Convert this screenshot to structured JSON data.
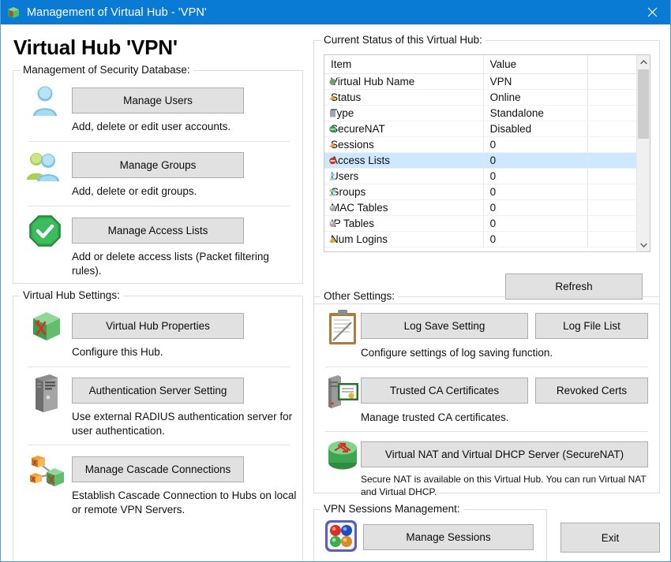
{
  "window": {
    "title": "Management of Virtual Hub - 'VPN'",
    "icon": "virtual-hub-cube-icon",
    "close_label": "✕",
    "accent_color": "#0a7bd4",
    "button_face": "#e1e1e1",
    "selection_color": "#cde8ff"
  },
  "page_title": "Virtual Hub 'VPN'",
  "security_db": {
    "legend": "Management of Security Database:",
    "items": [
      {
        "icon": "user-icon",
        "button": "Manage Users",
        "desc": "Add, delete or edit user accounts."
      },
      {
        "icon": "group-users-icon",
        "button": "Manage Groups",
        "desc": "Add, delete or edit groups."
      },
      {
        "icon": "green-check-icon",
        "button": "Manage Access Lists",
        "desc": "Add or delete access lists (Packet filtering rules)."
      }
    ]
  },
  "hub_settings": {
    "legend": "Virtual Hub Settings:",
    "items": [
      {
        "icon": "virtual-hub-cube-icon",
        "button": "Virtual Hub Properties",
        "desc": "Configure this Hub."
      },
      {
        "icon": "server-tower-icon",
        "button": "Authentication Server Setting",
        "desc": "Use external RADIUS authentication server for user authentication."
      },
      {
        "icon": "cascade-connection-icon",
        "button": "Manage Cascade Connections",
        "desc": "Establish Cascade Connection to Hubs on local or remote VPN Servers."
      }
    ]
  },
  "status": {
    "legend": "Current Status of this Virtual Hub:",
    "columns": [
      "Item",
      "Value",
      ""
    ],
    "rows": [
      {
        "icon": "hub-dot-icon",
        "item": "Virtual Hub Name",
        "value": "VPN",
        "selected": false
      },
      {
        "icon": "status-up-icon",
        "item": "Status",
        "value": "Online",
        "selected": false
      },
      {
        "icon": "type-icon",
        "item": "Type",
        "value": "Standalone",
        "selected": false
      },
      {
        "icon": "securenat-icon",
        "item": "SecureNAT",
        "value": "Disabled",
        "selected": false
      },
      {
        "icon": "session-icon",
        "item": "Sessions",
        "value": "0",
        "selected": false
      },
      {
        "icon": "access-list-icon",
        "item": "Access Lists",
        "value": "0",
        "selected": true
      },
      {
        "icon": "user-lock-icon",
        "item": "Users",
        "value": "0",
        "selected": false
      },
      {
        "icon": "groups-icon",
        "item": "Groups",
        "value": "0",
        "selected": false
      },
      {
        "icon": "mac-table-icon",
        "item": "MAC Tables",
        "value": "0",
        "selected": false
      },
      {
        "icon": "ip-table-icon",
        "item": "IP Tables",
        "value": "0",
        "selected": false
      },
      {
        "icon": "num-logins-icon",
        "item": "Num Logins",
        "value": "0",
        "selected": false
      }
    ],
    "refresh_label": "Refresh",
    "scroll_up": "⌃",
    "scroll_down": "⌄"
  },
  "other_settings": {
    "legend": "Other Settings:",
    "log": {
      "icon": "clipboard-log-icon",
      "button_primary": "Log Save Setting",
      "button_secondary": "Log File List",
      "desc": "Configure settings of log saving function."
    },
    "certs": {
      "icon": "certificate-server-icon",
      "button_primary": "Trusted CA Certificates",
      "button_secondary": "Revoked Certs",
      "desc": "Manage trusted CA certificates."
    },
    "securenat": {
      "icon": "nat-router-icon",
      "button": "Virtual NAT and Virtual DHCP Server (SecureNAT)",
      "desc": "Secure NAT is available on this Virtual Hub. You can run Virtual NAT and Virtual DHCP."
    }
  },
  "sessions": {
    "legend": "VPN Sessions Management:",
    "icon": "sessions-spheres-icon",
    "button": "Manage Sessions"
  },
  "exit_button": "Exit"
}
